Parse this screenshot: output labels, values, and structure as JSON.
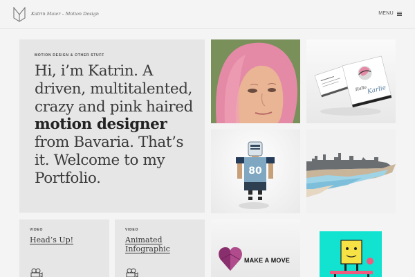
{
  "header": {
    "tagline": "Katrin Maier – Motion Design",
    "menu_label": "MENU"
  },
  "intro": {
    "kicker": "MOTION DESIGN & OTHER STUFF",
    "headline_before": "Hi, i’m Katrin. A driven, multitalented, crazy and pink haired ",
    "headline_bold": "motion designer",
    "headline_after": " from Bavaria. That’s it. Welcome to my Portfolio."
  },
  "tiles": {
    "robot_number": "80",
    "move_label": "MAKE A MOVE"
  },
  "videos": [
    {
      "kind": "VIDEO",
      "title": "Head’s Up!"
    },
    {
      "kind": "VIDEO",
      "title": "Animated Infographic"
    }
  ],
  "colors": {
    "background": "#f4f4f4",
    "panel": "#e6e6e6",
    "text": "#333333",
    "hair": "#e58aa6",
    "jersey": "#7fa7c2",
    "teal": "#12e2d0",
    "heart": "#8a2f6e"
  }
}
